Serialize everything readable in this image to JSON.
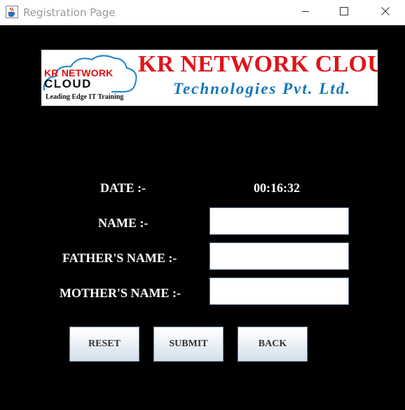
{
  "window": {
    "title": "Registration Page",
    "icons": {
      "app": "java-coffee-cup-icon",
      "minimize": "minimize-icon",
      "maximize": "maximize-icon",
      "close": "close-icon"
    }
  },
  "logo": {
    "kr_network": "KR NETWORK",
    "cloud": "CLOUD",
    "tagline": "Leading Edge IT Training",
    "main_text": "KR NETWORK CLOUD",
    "sub_text": "Technologies Pvt. Ltd.",
    "colors": {
      "red": "#e0141b",
      "blue": "#1276b9"
    }
  },
  "form": {
    "date_label": "DATE :-",
    "time_value": "00:16:32",
    "name_label": "NAME :-",
    "father_label": "FATHER'S NAME :-",
    "mother_label": "MOTHER'S NAME :-",
    "name_value": "",
    "father_value": "",
    "mother_value": ""
  },
  "buttons": {
    "reset": "RESET",
    "submit": "SUBMIT",
    "back": "BACK"
  }
}
